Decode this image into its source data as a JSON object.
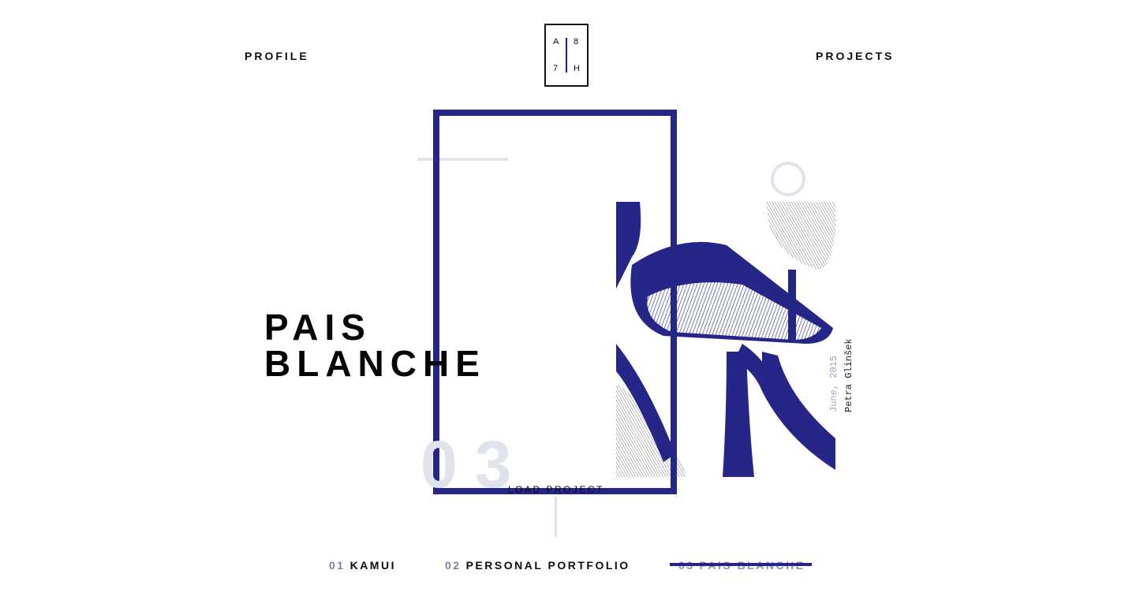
{
  "header": {
    "profile_label": "PROFILE",
    "projects_label": "PROJECTS",
    "logo": {
      "top_left": "A",
      "top_right": "8",
      "bottom_left": "7",
      "bottom_right": "H"
    }
  },
  "project": {
    "title_line1": "PAIS",
    "title_line2": "BLANCHE",
    "number": "03",
    "load_label": "LOAD PROJECT",
    "date": "June, 2015",
    "author": "Petra Glinšek"
  },
  "project_nav": [
    {
      "number": "01",
      "name": "KAMUI",
      "active": false
    },
    {
      "number": "02",
      "name": "PERSONAL PORTFOLIO",
      "active": false
    },
    {
      "number": "03",
      "name": "PAIS BLANCHE",
      "active": true
    }
  ],
  "colors": {
    "accent": "#262689",
    "muted": "#e1e3ec",
    "number_muted": "#7c82aa",
    "text": "#0c0c14"
  }
}
